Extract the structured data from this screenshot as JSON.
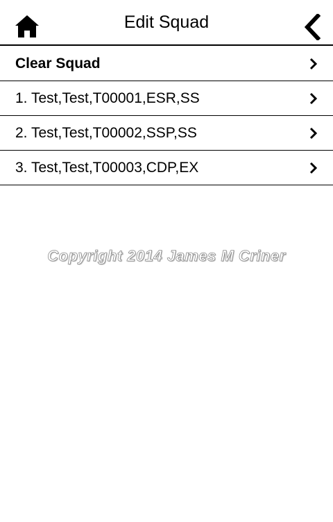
{
  "header": {
    "title": "Edit Squad",
    "home_icon": "home-icon",
    "back_icon": "chevron-left-icon"
  },
  "list": {
    "items": [
      {
        "label": "Clear Squad",
        "bold": true,
        "icon": "chevron-right-icon"
      },
      {
        "label": "1. Test,Test,T00001,ESR,SS",
        "bold": false,
        "icon": "chevron-right-icon"
      },
      {
        "label": "2. Test,Test,T00002,SSP,SS",
        "bold": false,
        "icon": "chevron-right-icon"
      },
      {
        "label": "3. Test,Test,T00003,CDP,EX",
        "bold": false,
        "icon": "chevron-right-icon"
      }
    ]
  },
  "watermark": {
    "text": "Copyright 2014 James M Criner"
  },
  "colors": {
    "background": "#ffffff",
    "text": "#000000",
    "divider": "#000000",
    "watermark_outline": "#8c8c8c"
  }
}
